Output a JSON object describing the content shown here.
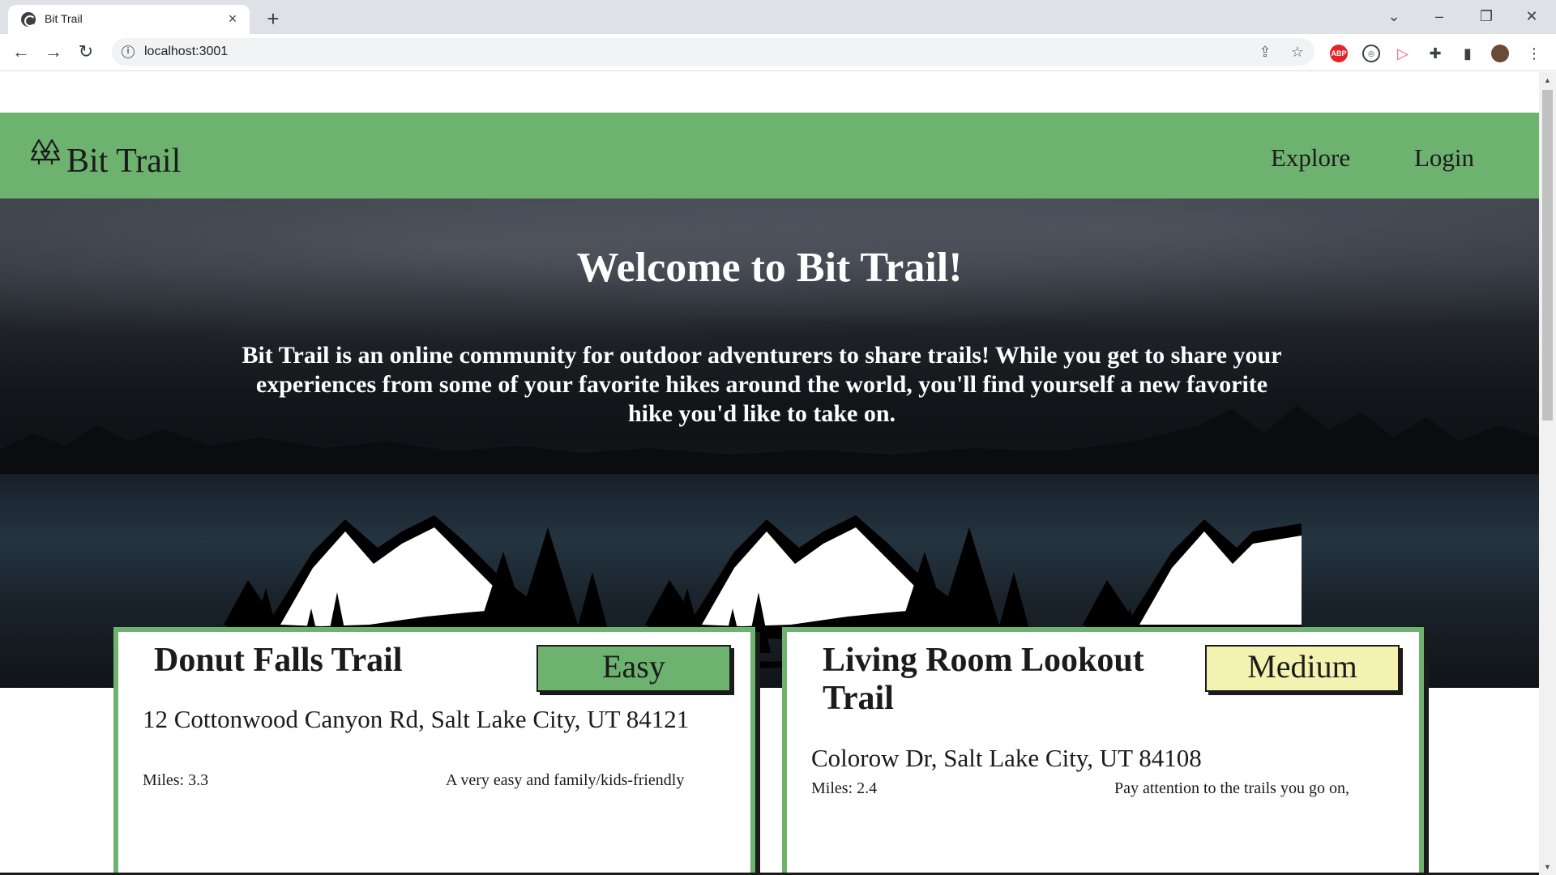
{
  "browser": {
    "tab_title": "Bit Trail",
    "url": "localhost:3001",
    "tab_close": "×",
    "new_tab": "+"
  },
  "site": {
    "brand": "Bit Trail",
    "nav": [
      "Explore",
      "Login"
    ],
    "colors": {
      "primary": "#6db26f",
      "medium": "#f3f2b0",
      "text": "#1b1b1b"
    }
  },
  "hero": {
    "title": "Welcome to Bit Trail!",
    "text": "Bit Trail is an online community for outdoor adventurers to share trails! While you get to share your experiences from some of your favorite hikes around the world, you'll find yourself a new favorite hike you'd like to take on."
  },
  "trails": [
    {
      "name": "Donut Falls Trail",
      "difficulty": "Easy",
      "address": "12 Cottonwood Canyon Rd, Salt Lake City, UT 84121",
      "miles": "Miles: 3.3",
      "description": "A very easy and family/kids-friendly"
    },
    {
      "name": "Living Room Lookout Trail",
      "difficulty": "Medium",
      "address": "Colorow Dr, Salt Lake City, UT 84108",
      "miles": "Miles: 2.4",
      "description": "Pay attention to the trails you go on,"
    }
  ],
  "icons": [
    "info-icon",
    "share-icon",
    "star-icon",
    "adblock-icon",
    "extension-icon",
    "puzzle-icon",
    "sidepanel-icon",
    "profile-avatar",
    "kebab-menu-icon",
    "tree-logo-icon"
  ]
}
